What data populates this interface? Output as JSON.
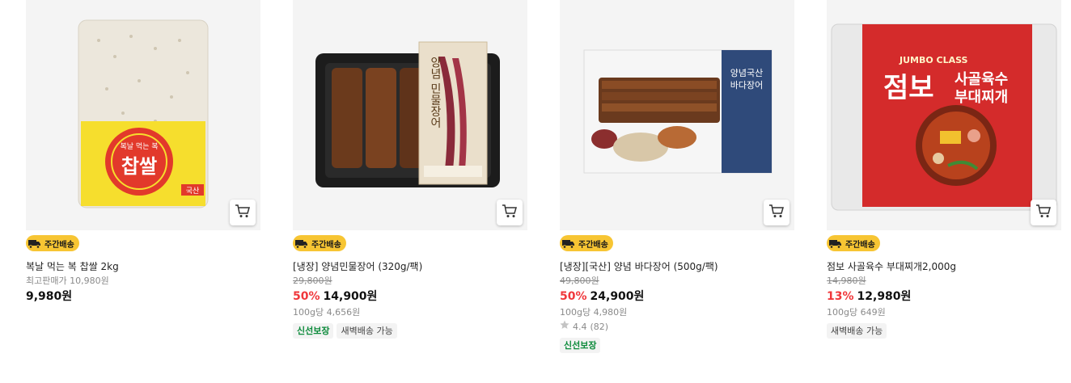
{
  "products": [
    {
      "badge": "주간배송",
      "image_alt": "찹쌀",
      "title": "복날 먹는 복 찹쌀 2kg",
      "max_price_label": "최고판매가 10,980원",
      "price": "9,980원"
    },
    {
      "badge": "주간배송",
      "image_alt": "양념민물장어",
      "title": "[냉장] 양념민물장어 (320g/팩)",
      "original_price": "29,800원",
      "discount": "50%",
      "price": "14,900원",
      "unit_price": "100g당 4,656원",
      "tags": [
        "신선보장",
        "새벽배송 가능"
      ]
    },
    {
      "badge": "주간배송",
      "image_alt": "양념국산 바다장어",
      "title": "[냉장][국산] 양념 바다장어 (500g/팩)",
      "original_price": "49,800원",
      "discount": "50%",
      "price": "24,900원",
      "unit_price": "100g당 4,980원",
      "rating": "4.4",
      "review_count": "(82)",
      "tags": [
        "신선보장"
      ]
    },
    {
      "badge": "주간배송",
      "image_alt": "점보 사골육수 부대찌개",
      "title": "점보 사골육수 부대찌개2,000g",
      "original_price": "14,980원",
      "discount": "13%",
      "price": "12,980원",
      "unit_price": "100g당 649원",
      "tags": [
        "새벽배송 가능"
      ]
    }
  ],
  "packaging_text": {
    "rice_label": "복날 먹는 복",
    "rice_big": "찹쌀",
    "rice_origin": "국산",
    "eel1_label": "양념 민물장어",
    "eel2_label_line1": "양념국산",
    "eel2_label_line2": "바다장어",
    "stew_top": "JUMBO CLASS",
    "stew_big": "점보",
    "stew_sub1": "사골육수",
    "stew_sub2": "부대찌개"
  },
  "colors": {
    "badge_bg": "#f7c533",
    "discount": "#f0373b",
    "fresh_tag": "#0b8a3a"
  }
}
